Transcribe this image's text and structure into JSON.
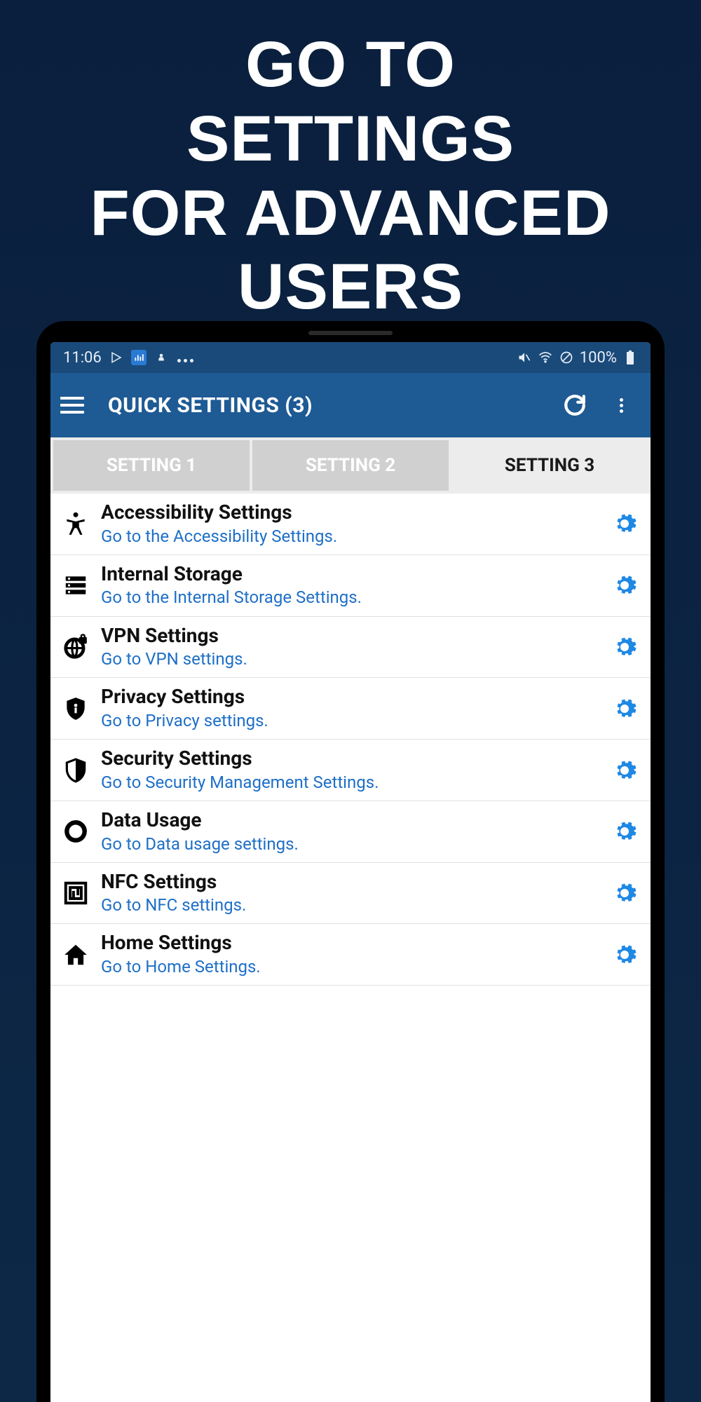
{
  "promo": {
    "line1": "GO TO",
    "line2": "SETTINGS",
    "line3": "FOR ADVANCED USERS"
  },
  "status_bar": {
    "time": "11:06",
    "battery": "100%"
  },
  "app_bar": {
    "title": "QUICK SETTINGS (3)"
  },
  "tabs": [
    {
      "label": "SETTING 1",
      "active": false
    },
    {
      "label": "SETTING 2",
      "active": false
    },
    {
      "label": "SETTING 3",
      "active": true
    }
  ],
  "items": [
    {
      "icon": "accessibility",
      "title": "Accessibility Settings",
      "subtitle": "Go to the Accessibility Settings."
    },
    {
      "icon": "storage",
      "title": "Internal Storage",
      "subtitle": "Go to the Internal Storage Settings."
    },
    {
      "icon": "vpn",
      "title": "VPN Settings",
      "subtitle": "Go to VPN settings."
    },
    {
      "icon": "privacy",
      "title": "Privacy Settings",
      "subtitle": "Go to Privacy settings."
    },
    {
      "icon": "security",
      "title": "Security Settings",
      "subtitle": "Go to Security Management Settings."
    },
    {
      "icon": "data",
      "title": "Data Usage",
      "subtitle": "Go to Data usage settings."
    },
    {
      "icon": "nfc",
      "title": "NFC Settings",
      "subtitle": "Go to NFC settings."
    },
    {
      "icon": "home",
      "title": "Home Settings",
      "subtitle": "Go to Home Settings."
    }
  ],
  "colors": {
    "accent": "#1e6fc7",
    "gear": "#1e88e5"
  }
}
